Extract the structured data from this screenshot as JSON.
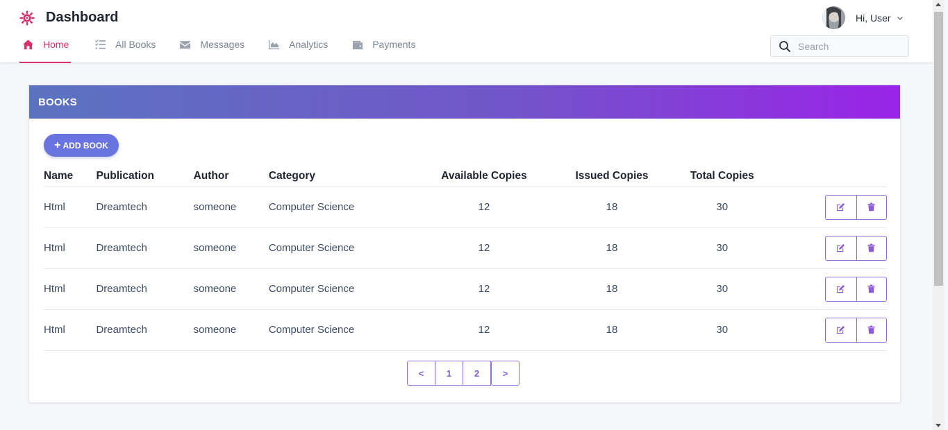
{
  "header": {
    "title": "Dashboard",
    "user_greeting": "Hi, User",
    "search_placeholder": "Search"
  },
  "nav": {
    "items": [
      {
        "label": "Home",
        "icon": "home-icon",
        "active": true
      },
      {
        "label": "All Books",
        "icon": "list-icon",
        "active": false
      },
      {
        "label": "Messages",
        "icon": "envelope-icon",
        "active": false
      },
      {
        "label": "Analytics",
        "icon": "area-chart-icon",
        "active": false
      },
      {
        "label": "Payments",
        "icon": "wallet-icon",
        "active": false
      }
    ]
  },
  "colors": {
    "accent": "#d6336c",
    "card_gradient_start": "#5b73c0",
    "card_gradient_end": "#9a23e8",
    "button": "#6a74e0",
    "action_border": "#8f6fd6"
  },
  "books": {
    "title": "BOOKS",
    "add_label": "ADD BOOK",
    "columns": [
      "Name",
      "Publication",
      "Author",
      "Category",
      "Available Copies",
      "Issued Copies",
      "Total Copies"
    ],
    "rows": [
      {
        "name": "Html",
        "publication": "Dreamtech",
        "author": "someone",
        "category": "Computer Science",
        "available": "12",
        "issued": "18",
        "total": "30"
      },
      {
        "name": "Html",
        "publication": "Dreamtech",
        "author": "someone",
        "category": "Computer Science",
        "available": "12",
        "issued": "18",
        "total": "30"
      },
      {
        "name": "Html",
        "publication": "Dreamtech",
        "author": "someone",
        "category": "Computer Science",
        "available": "12",
        "issued": "18",
        "total": "30"
      },
      {
        "name": "Html",
        "publication": "Dreamtech",
        "author": "someone",
        "category": "Computer Science",
        "available": "12",
        "issued": "18",
        "total": "30"
      }
    ]
  },
  "pagination": {
    "prev": "<",
    "pages": [
      "1",
      "2"
    ],
    "next": ">"
  }
}
